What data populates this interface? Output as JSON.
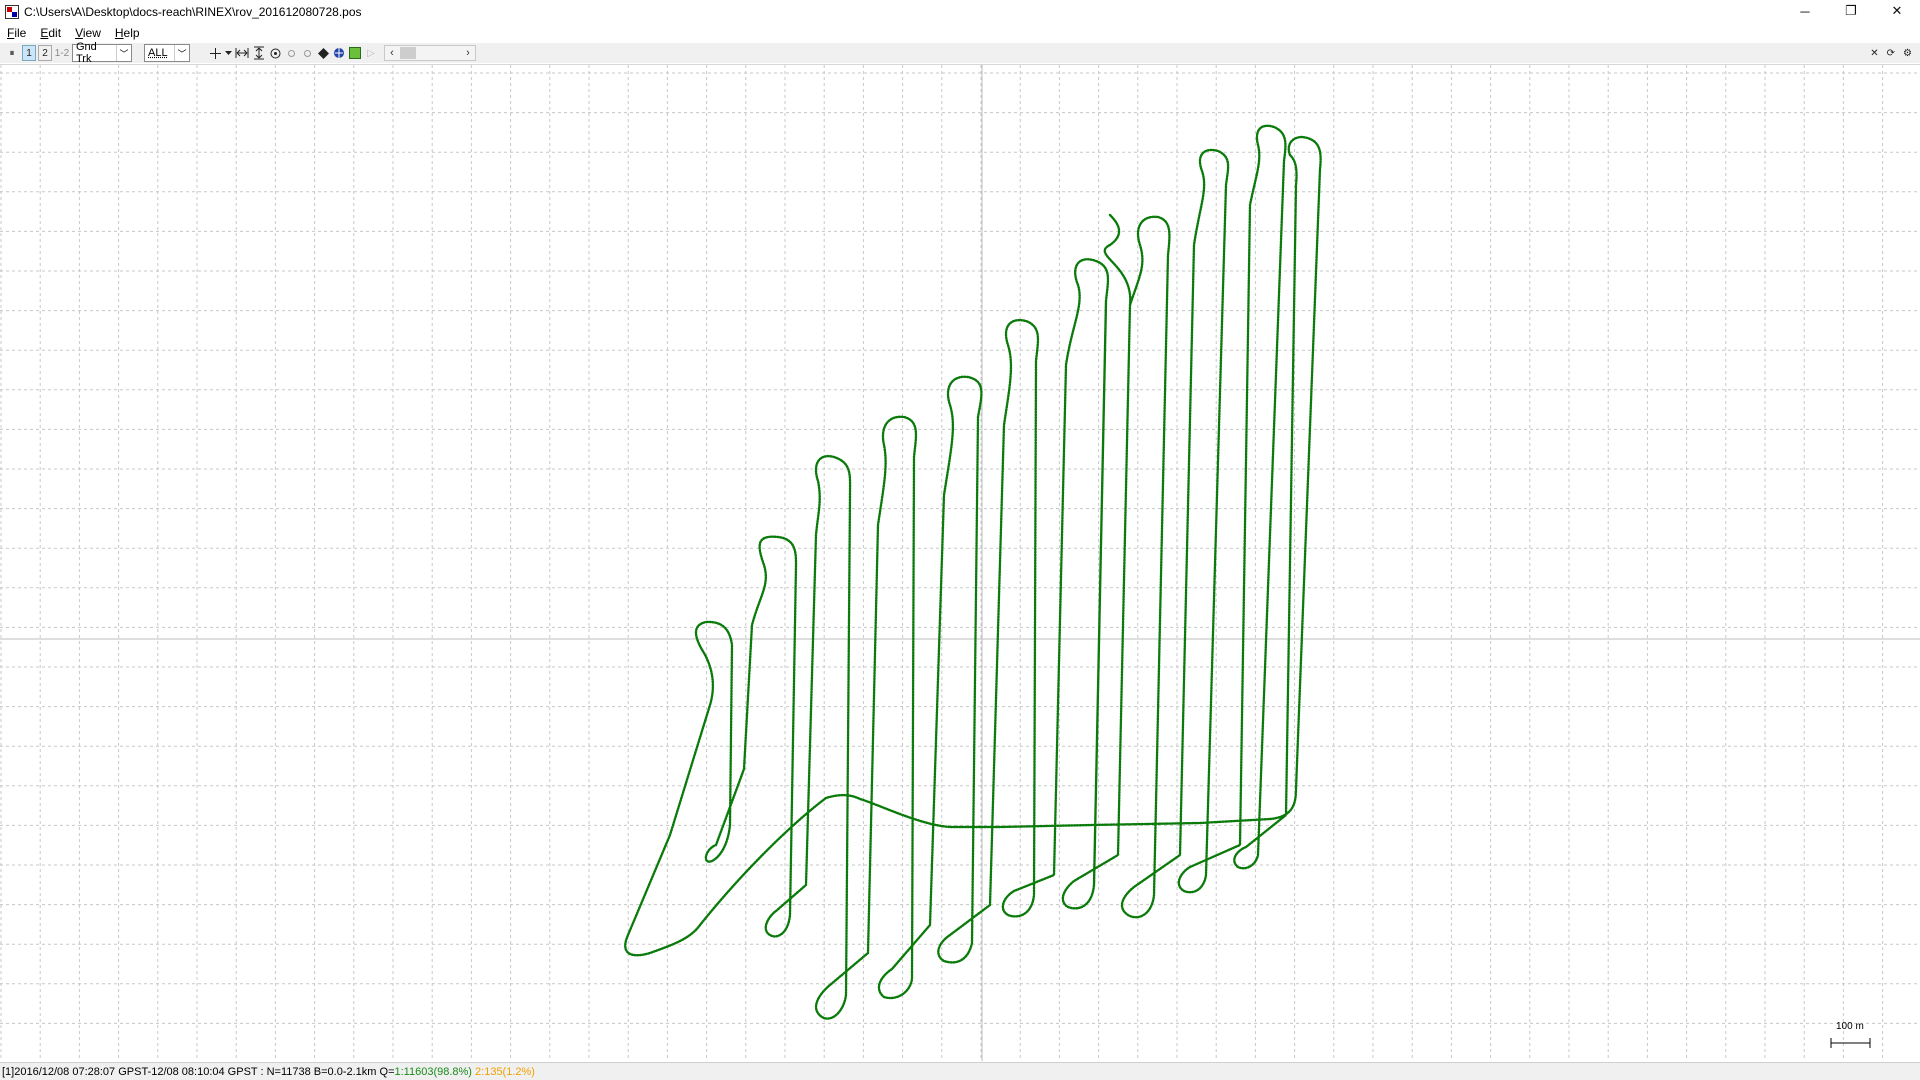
{
  "window": {
    "title": "C:\\Users\\A\\Desktop\\docs-reach\\RINEX\\rov_201612080728.pos",
    "minimize": "─",
    "restore": "❐",
    "close": "✕"
  },
  "menu": {
    "items": [
      {
        "label": "File",
        "key": "F",
        "rest": "ile"
      },
      {
        "label": "Edit",
        "key": "E",
        "rest": "dit"
      },
      {
        "label": "View",
        "key": "V",
        "rest": "iew"
      },
      {
        "label": "Help",
        "key": "H",
        "rest": "elp"
      }
    ]
  },
  "toolbar": {
    "pause_icon": "⏸",
    "btn1": "1",
    "btn2": "2",
    "btn12": "1-2",
    "plot_type": "Gnd Trk",
    "sat_select": "ALL",
    "close_icon": "✕",
    "refresh_icon": "⟳",
    "settings_icon": "⚙"
  },
  "plot": {
    "track_color": "#0a7a0a",
    "grid_color": "#c8c8c8",
    "scale_label": "100 m"
  },
  "status": {
    "prefix": "[1]2016/12/08 07:28:07 GPST-12/08 08:10:04 GPST : N=11738 B=0.0-2.1km Q=",
    "q1": "1:11603(98.8%)",
    "q2": "2:135(1.2%)"
  }
}
